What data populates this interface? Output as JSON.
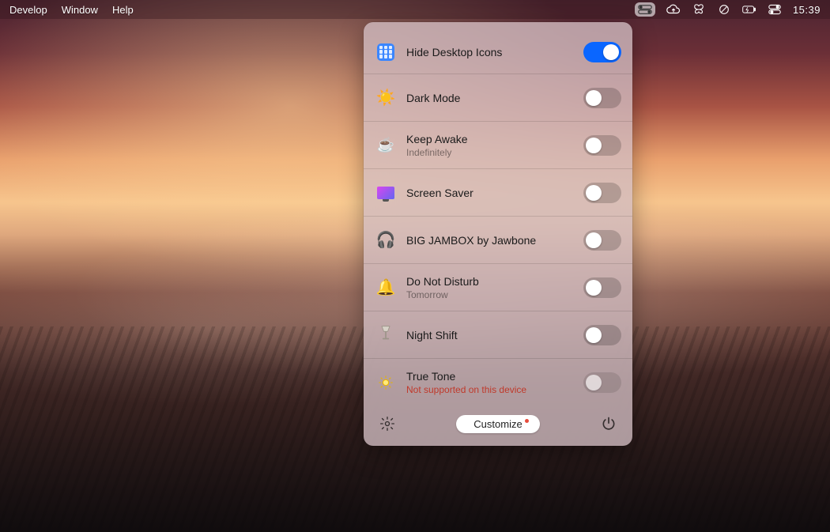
{
  "menubar": {
    "left_items": [
      "Develop",
      "Window",
      "Help"
    ],
    "clock": "15:39"
  },
  "panel": {
    "rows": [
      {
        "icon": "grid",
        "title": "Hide Desktop Icons",
        "subtitle": "",
        "subtitle_warn": false,
        "on": true,
        "disabled": false
      },
      {
        "icon": "sun",
        "title": "Dark Mode",
        "subtitle": "",
        "subtitle_warn": false,
        "on": false,
        "disabled": false
      },
      {
        "icon": "coffee",
        "title": "Keep Awake",
        "subtitle": "Indefinitely",
        "subtitle_warn": false,
        "on": false,
        "disabled": false
      },
      {
        "icon": "screensaver",
        "title": "Screen Saver",
        "subtitle": "",
        "subtitle_warn": false,
        "on": false,
        "disabled": false
      },
      {
        "icon": "headphones",
        "title": "BIG JAMBOX by Jawbone",
        "subtitle": "",
        "subtitle_warn": false,
        "on": false,
        "disabled": false
      },
      {
        "icon": "bell",
        "title": "Do Not Disturb",
        "subtitle": "Tomorrow",
        "subtitle_warn": false,
        "on": false,
        "disabled": false
      },
      {
        "icon": "lamp",
        "title": "Night Shift",
        "subtitle": "",
        "subtitle_warn": false,
        "on": false,
        "disabled": false
      },
      {
        "icon": "sunoutline",
        "title": "True Tone",
        "subtitle": "Not supported on this device",
        "subtitle_warn": true,
        "on": false,
        "disabled": true
      }
    ],
    "customize_label": "Customize"
  }
}
